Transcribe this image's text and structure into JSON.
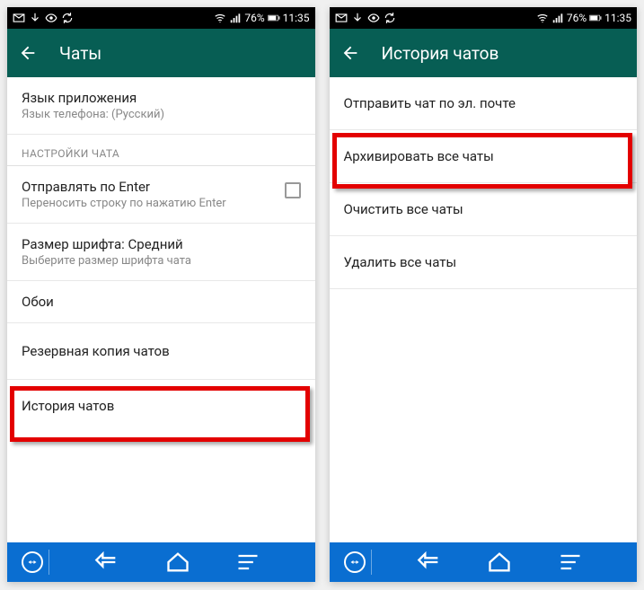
{
  "statusbar": {
    "battery": "76%",
    "time": "11:35"
  },
  "left": {
    "appbar_title": "Чаты",
    "lang_title": "Язык приложения",
    "lang_sub": "Язык телефона: (Русский)",
    "section_label": "НАСТРОЙКИ ЧАТА",
    "enter_title": "Отправлять по Enter",
    "enter_sub": "Переносить строку по нажатию Enter",
    "font_title": "Размер шрифта: Средний",
    "font_sub": "Выберите размер шрифта чата",
    "wallpaper": "Обои",
    "backup": "Резервная копия чатов",
    "history": "История чатов"
  },
  "right": {
    "appbar_title": "История чатов",
    "email": "Отправить чат по эл. почте",
    "archive": "Архивировать все чаты",
    "clear": "Очистить все чаты",
    "delete": "Удалить все чаты"
  }
}
